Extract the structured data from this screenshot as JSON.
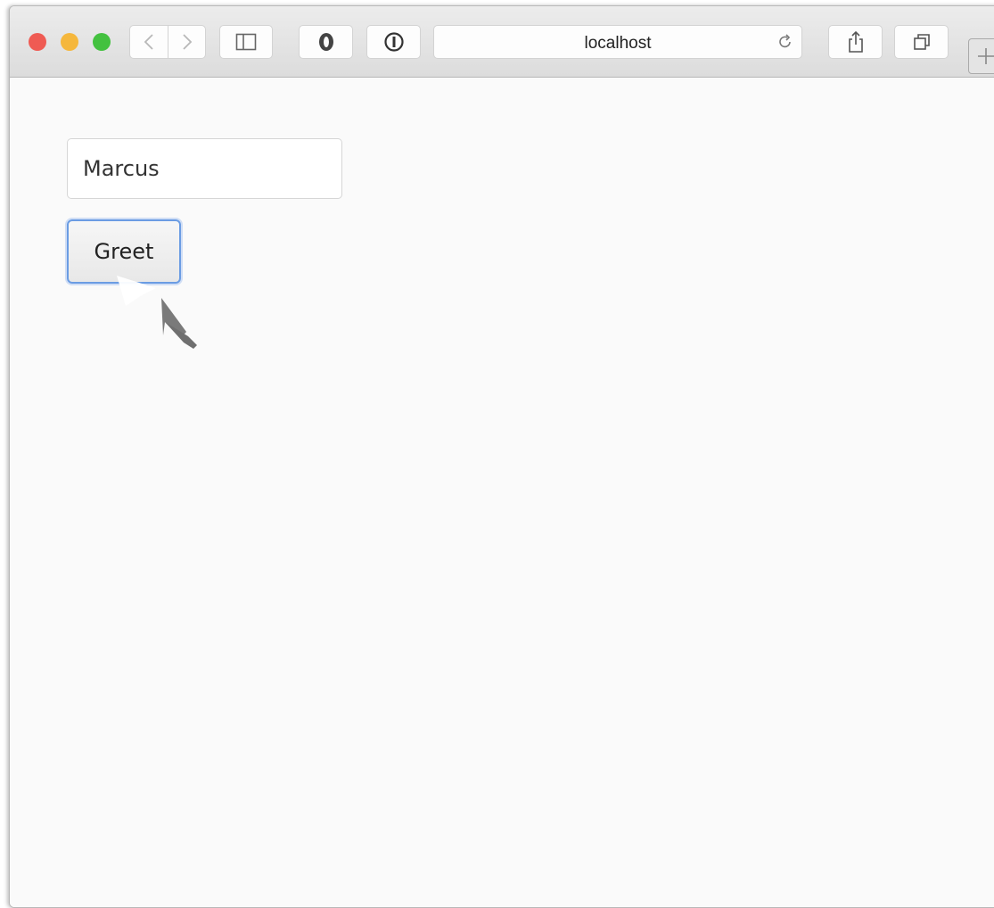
{
  "browser": {
    "address": "localhost",
    "traffic_colors": {
      "close": "#ef5b53",
      "minimize": "#f5b73c",
      "zoom": "#43c13f"
    },
    "toolbar_icons": [
      "back-icon",
      "forward-icon",
      "sidebar-icon",
      "extension-icon",
      "password-icon",
      "reload-icon",
      "share-icon",
      "tabs-icon",
      "new-tab-icon"
    ]
  },
  "form": {
    "name_value": "Marcus",
    "greet_label": "Greet"
  },
  "colors": {
    "button_focus": "#6a9ce3",
    "page_background": "#fafafa"
  }
}
